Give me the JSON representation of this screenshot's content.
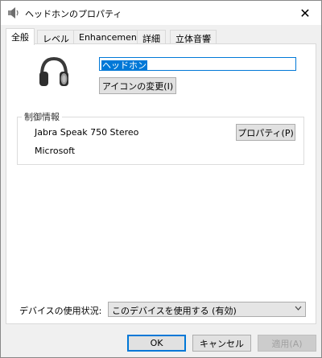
{
  "window": {
    "title": "ヘッドホンのプロパティ",
    "close_symbol": "✕"
  },
  "tabs": [
    {
      "label": "全般",
      "active": true
    },
    {
      "label": "レベル",
      "active": false
    },
    {
      "label": "Enhancements",
      "active": false
    },
    {
      "label": "詳細",
      "active": false
    },
    {
      "label": "立体音響",
      "active": false
    }
  ],
  "general": {
    "device_name": "ヘッドホン",
    "change_icon_label": "アイコンの変更(I)",
    "device_icon": "headphones-icon"
  },
  "controller": {
    "legend": "制御情報",
    "controller_name": "Jabra Speak 750 Stereo",
    "properties_label": "プロパティ(P)",
    "manufacturer": "Microsoft"
  },
  "usage": {
    "label": "デバイスの使用状況:",
    "selected": "このデバイスを使用する (有効)"
  },
  "footer": {
    "ok_label": "OK",
    "cancel_label": "キャンセル",
    "apply_label": "適用(A)"
  },
  "colors": {
    "accent": "#0078d7",
    "button_face": "#e1e1e1",
    "window_bg": "#f0f0f0"
  }
}
